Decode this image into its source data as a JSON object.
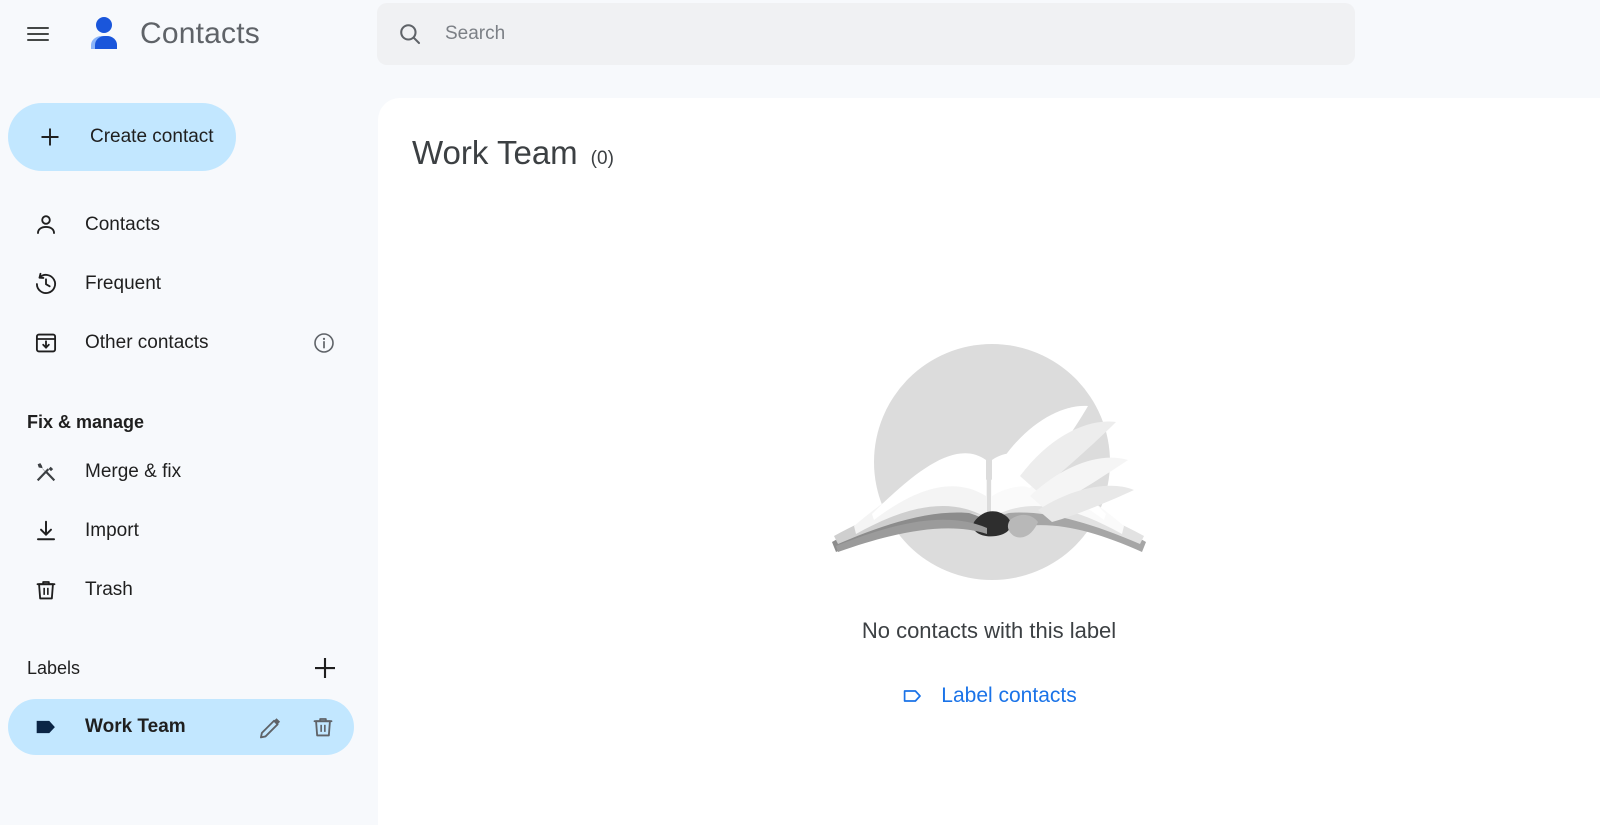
{
  "app": {
    "title": "Contacts",
    "logo_icon": "contacts-person-logo",
    "menu_icon": "hamburger-menu-icon",
    "colors": {
      "accent_blue": "#1a73e8",
      "selected_chip": "#c2e7ff",
      "logo_dark_blue": "#1a56db",
      "logo_light_blue": "#8ab4f8",
      "sidebar_bg": "#f7f9fc",
      "panel_bg": "#ffffff",
      "search_bg": "#f0f1f3",
      "label_tag_color": "#0b2545"
    }
  },
  "search": {
    "placeholder": "Search",
    "value": "",
    "icon": "search-icon"
  },
  "sidebar": {
    "create_button": {
      "label": "Create contact",
      "icon": "plus-icon"
    },
    "nav_items": [
      {
        "label": "Contacts",
        "icon": "person-icon"
      },
      {
        "label": "Frequent",
        "icon": "history-clock-icon"
      },
      {
        "label": "Other contacts",
        "icon": "archive-download-icon",
        "trailing_icon": "info-icon"
      }
    ],
    "fix_manage_header": "Fix & manage",
    "fix_manage_items": [
      {
        "label": "Merge & fix",
        "icon": "merge-tools-icon"
      },
      {
        "label": "Import",
        "icon": "import-download-icon"
      },
      {
        "label": "Trash",
        "icon": "trash-icon"
      }
    ],
    "labels_header": {
      "title": "Labels",
      "add_icon": "plus-icon"
    },
    "labels": [
      {
        "name": "Work Team",
        "icon": "label-tag-icon",
        "selected": true,
        "edit_icon": "pencil-edit-icon",
        "delete_icon": "trash-delete-icon"
      }
    ]
  },
  "main": {
    "page_title": "Work Team",
    "count": "(0)",
    "empty_state": {
      "illustration": "open-book-illustration",
      "message": "No contacts with this label",
      "action_label": "Label contacts",
      "action_icon": "label-tag-outline-icon"
    }
  }
}
